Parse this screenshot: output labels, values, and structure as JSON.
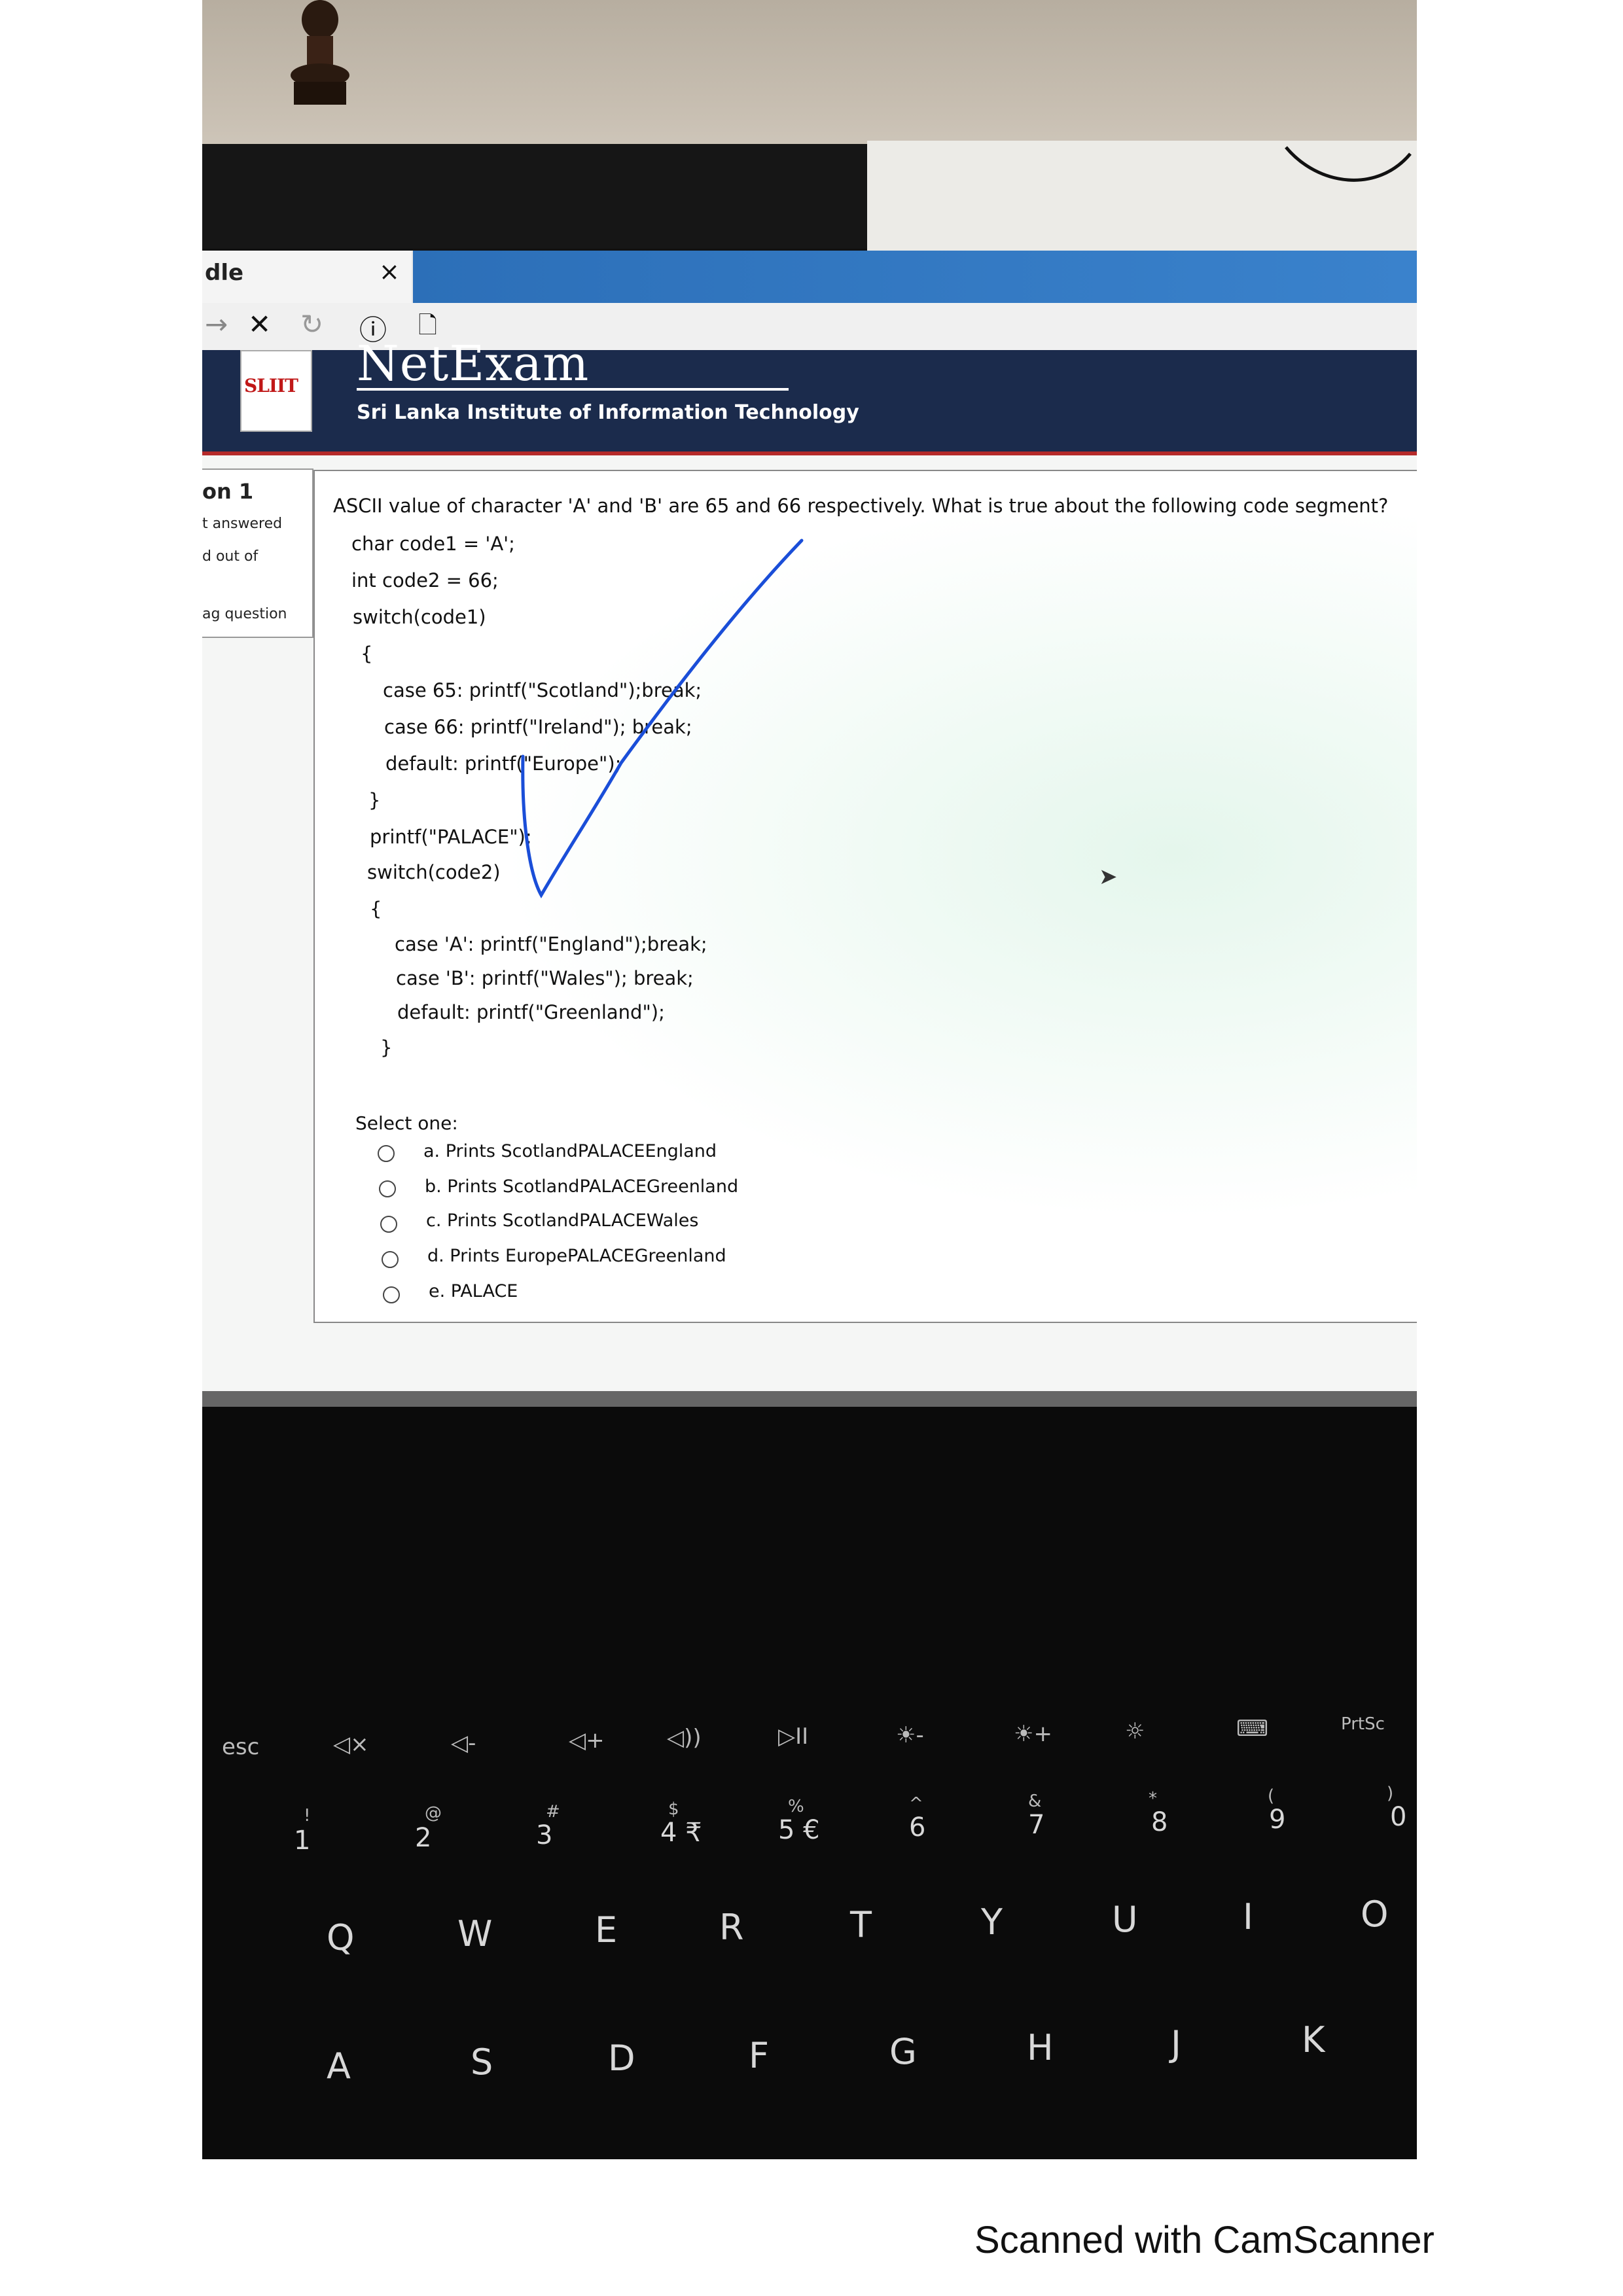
{
  "browser": {
    "tab_title": "dle",
    "tab_close": "×",
    "toolbar": {
      "back": "→",
      "stop": "✕",
      "reload": "↻",
      "info": "ⓘ",
      "page": "🗋"
    }
  },
  "site": {
    "logo_text": "SLIIT",
    "brand": "NetExam",
    "subtitle": "Sri Lanka Institute of Information Technology"
  },
  "nav": {
    "question_label": "on 1",
    "status": "t answered",
    "marks": "d out of",
    "flag": "ag question"
  },
  "question": {
    "text": "ASCII value of character 'A' and 'B' are 65 and 66 respectively. What is true about the following code segment?",
    "code_lines": [
      "char code1 = 'A';",
      "int code2 = 66;",
      "switch(code1)",
      "{",
      "case 65: printf(\"Scotland\");break;",
      "case 66: printf(\"Ireland\"); break;",
      "default: printf(\"Europe\");",
      "}",
      "printf(\"PALACE\");",
      "switch(code2)",
      "{",
      "case 'A': printf(\"England\");break;",
      "case 'B': printf(\"Wales\"); break;",
      "default: printf(\"Greenland\");",
      "}"
    ],
    "select_label": "Select one:",
    "options": [
      "a. Prints ScotlandPALACEEngland",
      "b. Prints ScotlandPALACEGreenland",
      "c. Prints ScotlandPALACEWales",
      "d. Prints EuropePALACEGreenland",
      "e. PALACE"
    ]
  },
  "keyboard": {
    "fn_row": [
      "esc",
      "◁×",
      "◁-",
      "◁+",
      "◁))",
      "▷II",
      "☀-",
      "☀+",
      "☼",
      "⌨",
      "PrtSc"
    ],
    "num_row": [
      "1",
      "2",
      "3",
      "4 ₹",
      "5 €",
      "6",
      "7",
      "8",
      "9",
      "0"
    ],
    "num_symbols": [
      "!",
      "@",
      "#",
      "$",
      "%",
      "^",
      "&",
      "*",
      "(",
      ")"
    ],
    "qwerty": [
      "Q",
      "W",
      "E",
      "R",
      "T",
      "Y",
      "U",
      "I",
      "O"
    ],
    "asdf": [
      "A",
      "S",
      "D",
      "F",
      "G",
      "H",
      "J",
      "K"
    ]
  },
  "watermark": "Scanned with CamScanner"
}
